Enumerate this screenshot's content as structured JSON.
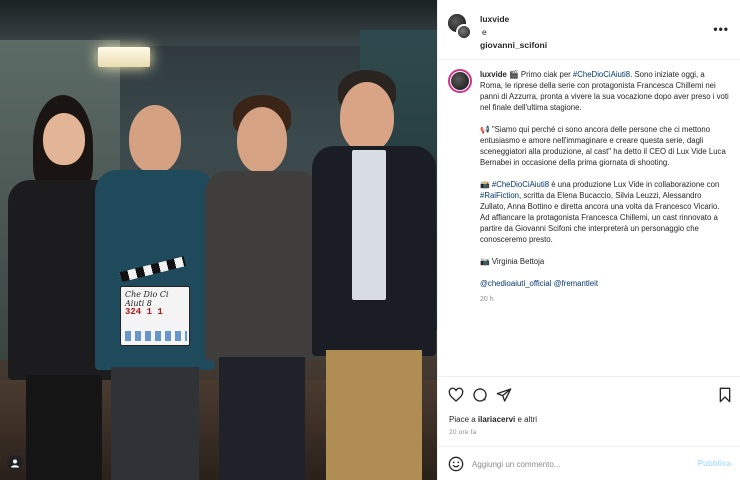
{
  "post": {
    "header": {
      "author_1": "luxvide",
      "conjunction": "e",
      "author_2": "giovanni_scifoni",
      "more_icon": "more-horizontal-icon"
    },
    "caption": {
      "username": "luxvide",
      "line1_text": "🎬 Primo ciak per ",
      "line1_hashtag": "#CheDioCiAiuti8",
      "line1_end": ".",
      "line1_rest": "Sono iniziate oggi, a Roma, le riprese della serie con protagonista Francesca Chillemi nei panni di Azzurra, pronta a vivere la sua vocazione dopo aver preso i voti nel finale dell'ultima stagione.",
      "quote": "📢 \"Siamo qui perché ci sono ancora delle persone che ci mettono entusiasmo e amore nell'immaginare e creare questa serie, dagli sceneggiatori alla produzione, al cast\" ha detto il CEO di Lux Vide Luca Bernabei in occasione della prima giornata di shooting.",
      "para3_prefix": "📸 ",
      "para3_hashtag": "#CheDioCiAiuti8",
      "para3_mid": " è una produzione Lux Vide in collaborazione con ",
      "para3_hashtag2": "#RaiFiction",
      "para3_rest": ", scritta da Elena Bucaccio, Silvia Leuzzi, Alessandro Zullato, Anna Bottino e diretta ancora una volta da Francesco Vicario. Ad affiancare la protagonista Francesca Chillemi, un cast rinnovato a partire da Giovanni Scifoni che interpreterà un personaggio che conosceremo presto.",
      "credit": "📷 Virginia Bettoja",
      "mention_1": "@chedioaiuti_official",
      "mention_2": "@fremantleit",
      "time": "20 h"
    },
    "actions": {
      "icons": [
        "heart-icon",
        "comment-icon",
        "share-icon",
        "bookmark-icon"
      ],
      "likes_prefix": "Piace a ",
      "likes_user": "ilariacervi",
      "likes_suffix": " e altri",
      "ago": "20 ore fa",
      "comment_placeholder": "Aggiungi un commento...",
      "publish_label": "Pubblica"
    },
    "photo": {
      "clapper_title": "Che Dio Ci Aiuti 8",
      "clapper_numbers": "324   1   1"
    }
  },
  "colors": {
    "link": "#00376b",
    "muted": "#8e8e8e",
    "publish": "#b2dffc",
    "story_ring": "#d0318a"
  }
}
